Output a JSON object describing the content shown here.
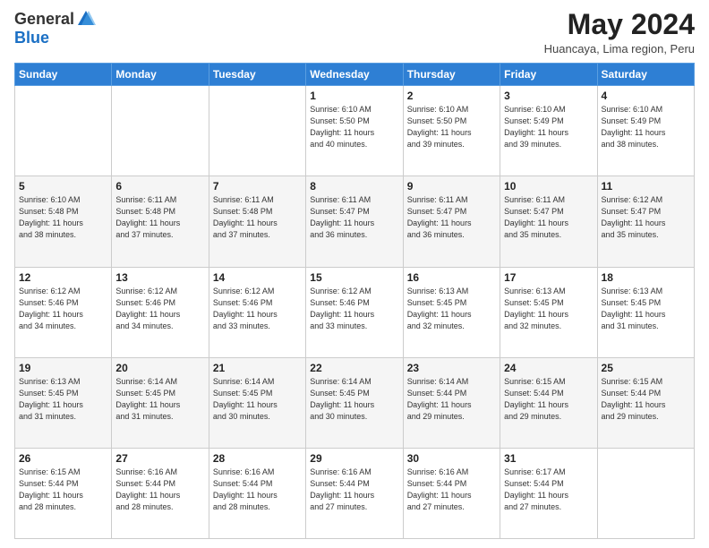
{
  "logo": {
    "general": "General",
    "blue": "Blue"
  },
  "header": {
    "month": "May 2024",
    "location": "Huancaya, Lima region, Peru"
  },
  "days_of_week": [
    "Sunday",
    "Monday",
    "Tuesday",
    "Wednesday",
    "Thursday",
    "Friday",
    "Saturday"
  ],
  "weeks": [
    [
      {
        "day": "",
        "info": ""
      },
      {
        "day": "",
        "info": ""
      },
      {
        "day": "",
        "info": ""
      },
      {
        "day": "1",
        "info": "Sunrise: 6:10 AM\nSunset: 5:50 PM\nDaylight: 11 hours\nand 40 minutes."
      },
      {
        "day": "2",
        "info": "Sunrise: 6:10 AM\nSunset: 5:50 PM\nDaylight: 11 hours\nand 39 minutes."
      },
      {
        "day": "3",
        "info": "Sunrise: 6:10 AM\nSunset: 5:49 PM\nDaylight: 11 hours\nand 39 minutes."
      },
      {
        "day": "4",
        "info": "Sunrise: 6:10 AM\nSunset: 5:49 PM\nDaylight: 11 hours\nand 38 minutes."
      }
    ],
    [
      {
        "day": "5",
        "info": "Sunrise: 6:10 AM\nSunset: 5:48 PM\nDaylight: 11 hours\nand 38 minutes."
      },
      {
        "day": "6",
        "info": "Sunrise: 6:11 AM\nSunset: 5:48 PM\nDaylight: 11 hours\nand 37 minutes."
      },
      {
        "day": "7",
        "info": "Sunrise: 6:11 AM\nSunset: 5:48 PM\nDaylight: 11 hours\nand 37 minutes."
      },
      {
        "day": "8",
        "info": "Sunrise: 6:11 AM\nSunset: 5:47 PM\nDaylight: 11 hours\nand 36 minutes."
      },
      {
        "day": "9",
        "info": "Sunrise: 6:11 AM\nSunset: 5:47 PM\nDaylight: 11 hours\nand 36 minutes."
      },
      {
        "day": "10",
        "info": "Sunrise: 6:11 AM\nSunset: 5:47 PM\nDaylight: 11 hours\nand 35 minutes."
      },
      {
        "day": "11",
        "info": "Sunrise: 6:12 AM\nSunset: 5:47 PM\nDaylight: 11 hours\nand 35 minutes."
      }
    ],
    [
      {
        "day": "12",
        "info": "Sunrise: 6:12 AM\nSunset: 5:46 PM\nDaylight: 11 hours\nand 34 minutes."
      },
      {
        "day": "13",
        "info": "Sunrise: 6:12 AM\nSunset: 5:46 PM\nDaylight: 11 hours\nand 34 minutes."
      },
      {
        "day": "14",
        "info": "Sunrise: 6:12 AM\nSunset: 5:46 PM\nDaylight: 11 hours\nand 33 minutes."
      },
      {
        "day": "15",
        "info": "Sunrise: 6:12 AM\nSunset: 5:46 PM\nDaylight: 11 hours\nand 33 minutes."
      },
      {
        "day": "16",
        "info": "Sunrise: 6:13 AM\nSunset: 5:45 PM\nDaylight: 11 hours\nand 32 minutes."
      },
      {
        "day": "17",
        "info": "Sunrise: 6:13 AM\nSunset: 5:45 PM\nDaylight: 11 hours\nand 32 minutes."
      },
      {
        "day": "18",
        "info": "Sunrise: 6:13 AM\nSunset: 5:45 PM\nDaylight: 11 hours\nand 31 minutes."
      }
    ],
    [
      {
        "day": "19",
        "info": "Sunrise: 6:13 AM\nSunset: 5:45 PM\nDaylight: 11 hours\nand 31 minutes."
      },
      {
        "day": "20",
        "info": "Sunrise: 6:14 AM\nSunset: 5:45 PM\nDaylight: 11 hours\nand 31 minutes."
      },
      {
        "day": "21",
        "info": "Sunrise: 6:14 AM\nSunset: 5:45 PM\nDaylight: 11 hours\nand 30 minutes."
      },
      {
        "day": "22",
        "info": "Sunrise: 6:14 AM\nSunset: 5:45 PM\nDaylight: 11 hours\nand 30 minutes."
      },
      {
        "day": "23",
        "info": "Sunrise: 6:14 AM\nSunset: 5:44 PM\nDaylight: 11 hours\nand 29 minutes."
      },
      {
        "day": "24",
        "info": "Sunrise: 6:15 AM\nSunset: 5:44 PM\nDaylight: 11 hours\nand 29 minutes."
      },
      {
        "day": "25",
        "info": "Sunrise: 6:15 AM\nSunset: 5:44 PM\nDaylight: 11 hours\nand 29 minutes."
      }
    ],
    [
      {
        "day": "26",
        "info": "Sunrise: 6:15 AM\nSunset: 5:44 PM\nDaylight: 11 hours\nand 28 minutes."
      },
      {
        "day": "27",
        "info": "Sunrise: 6:16 AM\nSunset: 5:44 PM\nDaylight: 11 hours\nand 28 minutes."
      },
      {
        "day": "28",
        "info": "Sunrise: 6:16 AM\nSunset: 5:44 PM\nDaylight: 11 hours\nand 28 minutes."
      },
      {
        "day": "29",
        "info": "Sunrise: 6:16 AM\nSunset: 5:44 PM\nDaylight: 11 hours\nand 27 minutes."
      },
      {
        "day": "30",
        "info": "Sunrise: 6:16 AM\nSunset: 5:44 PM\nDaylight: 11 hours\nand 27 minutes."
      },
      {
        "day": "31",
        "info": "Sunrise: 6:17 AM\nSunset: 5:44 PM\nDaylight: 11 hours\nand 27 minutes."
      },
      {
        "day": "",
        "info": ""
      }
    ]
  ]
}
